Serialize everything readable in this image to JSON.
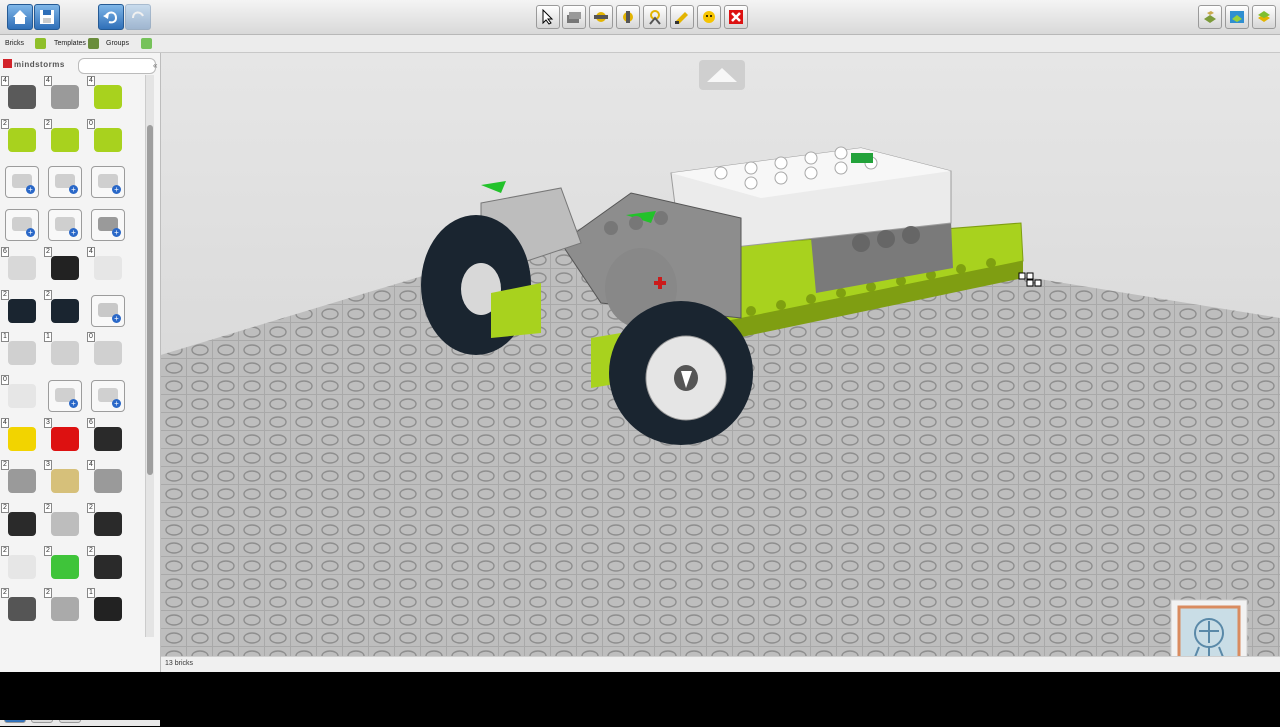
{
  "tabs": [
    {
      "label": "Bricks"
    },
    {
      "label": "Templates"
    },
    {
      "label": "Groups"
    }
  ],
  "panel": {
    "brand": "mindstorms",
    "search_placeholder": ""
  },
  "palette_counts": [
    "4",
    "4",
    "4",
    "2",
    "2",
    "0",
    "",
    "",
    "",
    "",
    "",
    "",
    "6",
    "2",
    "4",
    "2",
    "2",
    "",
    "1",
    "1",
    "0",
    "0",
    "",
    "",
    "4",
    "3",
    "6",
    "2",
    "3",
    "4",
    "2",
    "2",
    "2",
    "2",
    "2",
    "2",
    "2",
    "2",
    "1"
  ],
  "status": {
    "brick_count": "13 bricks"
  },
  "colors": {
    "lime": "#a8d21e",
    "dark_gray": "#5d5d5d",
    "light_gray": "#c8c8c8",
    "white": "#f2f2f2",
    "tire": "#1a2530",
    "red": "#cc1b1b",
    "green_accent": "#22c22a",
    "baseplate": "#bdbdbd"
  },
  "toolbar_icons": [
    "home-icon",
    "save-icon",
    "undo-icon",
    "redo-icon",
    "select-icon",
    "clone-icon",
    "hinge-icon",
    "hinge-align-icon",
    "flex-icon",
    "paint-icon",
    "decorate-icon",
    "delete-icon",
    "build-mode-icon",
    "view-mode-icon",
    "building-guide-icon"
  ]
}
